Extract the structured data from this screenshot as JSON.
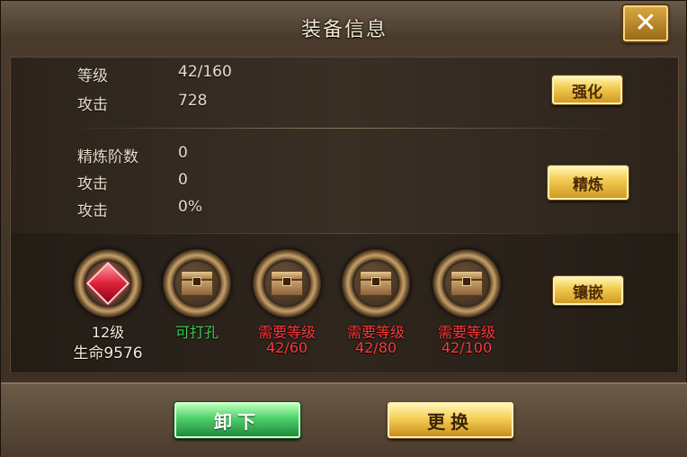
{
  "dialog": {
    "title": "装备信息",
    "close_label": "✕"
  },
  "enhance": {
    "rows": [
      {
        "label": "等级",
        "value": "42/160"
      },
      {
        "label": "攻击",
        "value": "728"
      }
    ],
    "button_label": "强化"
  },
  "refine": {
    "rows": [
      {
        "label": "精炼阶数",
        "value": "0"
      },
      {
        "label": "攻击",
        "value": "0"
      },
      {
        "label": "攻击",
        "value": "0%"
      }
    ],
    "button_label": "精炼"
  },
  "sockets": [
    {
      "icon": "red-gem-icon",
      "line1": "12级",
      "line2": "生命9576",
      "color": "#f3ead8"
    },
    {
      "icon": "chest-icon",
      "line1": "可打孔",
      "line2": "",
      "color": "#3cd14a"
    },
    {
      "icon": "chest-icon",
      "line1": "需要等级",
      "line2": "42/60",
      "color": "#ff3b3b"
    },
    {
      "icon": "chest-icon",
      "line1": "需要等级",
      "line2": "42/80",
      "color": "#ff3b3b"
    },
    {
      "icon": "chest-icon",
      "line1": "需要等级",
      "line2": "42/100",
      "color": "#ff3b3b"
    }
  ],
  "inlay_button_label": "镶嵌",
  "footer": {
    "unequip_label": "卸下",
    "replace_label": "更换"
  }
}
